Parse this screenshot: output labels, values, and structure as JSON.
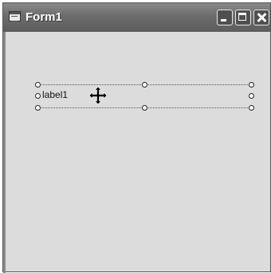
{
  "window": {
    "title": "Form1",
    "app_icon": "form-window-icon",
    "buttons": [
      "minimize-icon",
      "maximize-icon",
      "close-icon"
    ]
  },
  "designer": {
    "label_text": "label1",
    "cursor_icon": "move-cursor-icon"
  },
  "colors": {
    "form_background": "#dcdcdc",
    "titlebar": "#6e6e6e",
    "titlebar_text": "#ffffff"
  }
}
